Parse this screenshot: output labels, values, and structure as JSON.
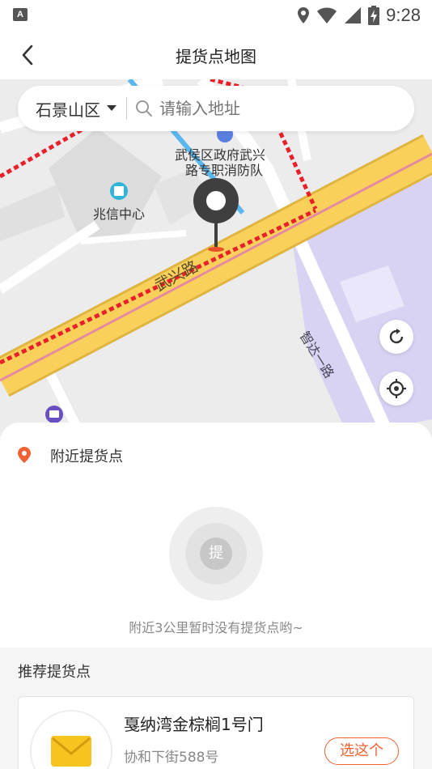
{
  "status_bar": {
    "app_icon": "A",
    "time": "9:28",
    "icons": [
      "location-icon",
      "wifi-icon",
      "signal-icon",
      "battery-charging-icon"
    ]
  },
  "nav": {
    "title": "提货点地图",
    "back_icon": "chevron-left-icon"
  },
  "search": {
    "district": "石景山区",
    "placeholder": "请输入地址"
  },
  "map": {
    "labels": {
      "poi_fire": "武侯区政府武兴",
      "poi_fire_2": "路专职消防队",
      "poi_building": "兆信中心",
      "road_main": "武兴路",
      "road_side": "智达一路"
    },
    "colors": {
      "road_main": "#f9d15a",
      "boundary": "#e8202a",
      "park": "#d7d1f2",
      "blue_poi": "#3a8ee6",
      "pin": "#4a4a4a"
    }
  },
  "sheet": {
    "nearby_label": "附近提货点",
    "empty_icon_text": "提",
    "empty_text": "附近3公里暂时没有提货点哟~",
    "recommend_title": "推荐提货点",
    "card": {
      "name": "戛纳湾金棕榈1号门",
      "address": "协和下街588号",
      "choose_label": "选这个"
    }
  },
  "accent_color": "#f06233"
}
